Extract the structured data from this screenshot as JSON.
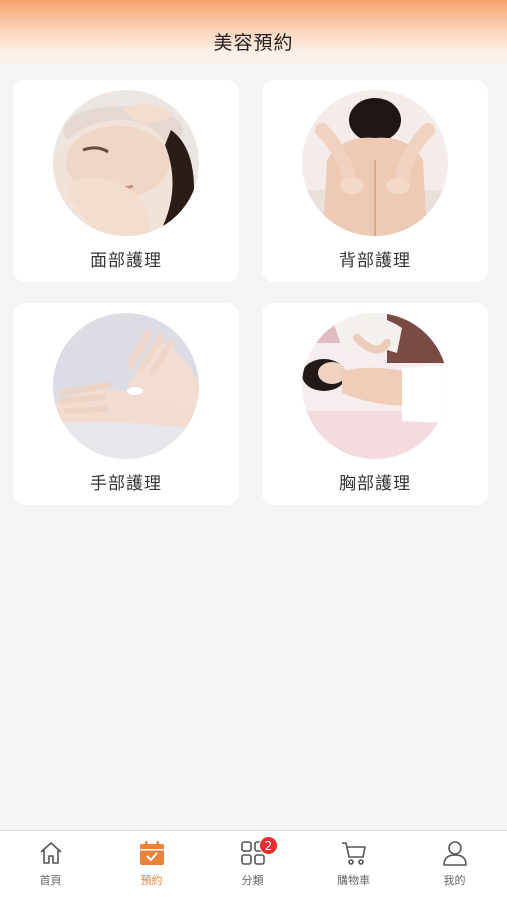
{
  "header": {
    "title": "美容預約"
  },
  "services": [
    {
      "label": "面部護理",
      "image": "facial-massage-photo"
    },
    {
      "label": "背部護理",
      "image": "back-massage-photo"
    },
    {
      "label": "手部護理",
      "image": "hand-care-photo"
    },
    {
      "label": "胸部護理",
      "image": "chest-care-photo"
    }
  ],
  "tabbar": {
    "active": "預約",
    "items": [
      {
        "label": "首頁",
        "icon": "home-icon"
      },
      {
        "label": "預約",
        "icon": "calendar-check-icon"
      },
      {
        "label": "分類",
        "icon": "grid-icon",
        "badge": "2"
      },
      {
        "label": "購物車",
        "icon": "cart-icon"
      },
      {
        "label": "我的",
        "icon": "user-icon"
      }
    ]
  },
  "colors": {
    "accent": "#e8813a",
    "badge": "#e62d2d",
    "header_top": "#f5a36e",
    "background": "#f4f4f4"
  }
}
